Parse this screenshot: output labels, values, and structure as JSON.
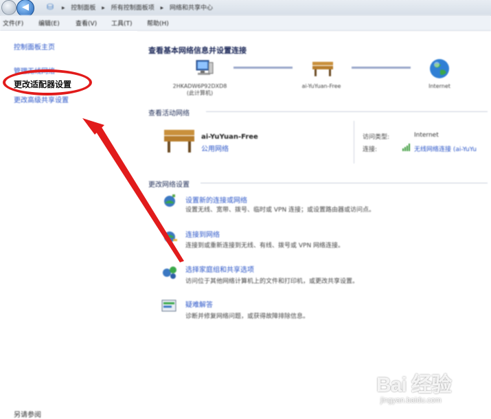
{
  "breadcrumb": [
    "▸",
    "控制面板",
    "▸",
    "所有控制面板项",
    "▸",
    "网络和共享中心"
  ],
  "menu": [
    "文件(F)",
    "编辑(E)",
    "查看(V)",
    "工具(T)",
    "帮助(H)"
  ],
  "left_panel": {
    "home": "控制面板主页",
    "manage_wireless": "管理无线网络",
    "change_adapter": "更改适配器设置",
    "change_sharing": "更改高级共享设置",
    "see_also": "另请参阅"
  },
  "main": {
    "title": "查看基本网络信息并设置连接",
    "map": {
      "computer_name": "2HKADW6P92DXD8",
      "computer_sub": "(此计算机)",
      "network_name": "ai-YuYuan-Free",
      "internet": "Internet"
    },
    "active_header": "查看活动网络",
    "active": {
      "name": "ai-YuYuan-Free",
      "type": "公用网络",
      "access_label": "访问类型:",
      "access_value": "Internet",
      "conn_label": "连接:",
      "conn_value": "无线网络连接 (ai-YuYu"
    },
    "change_header": "更改网络设置",
    "tasks": [
      {
        "title": "设置新的连接或网络",
        "desc": "设置无线、宽带、拨号、临时或 VPN 连接；或设置路由器或访问点。"
      },
      {
        "title": "连接到网络",
        "desc": "连接到或重新连接到无线、有线、拨号或 VPN 网络连接。"
      },
      {
        "title": "选择家庭组和共享选项",
        "desc": "访问位于其他网络计算机上的文件和打印机，或更改共享设置。"
      },
      {
        "title": "疑难解答",
        "desc": "诊断并修复网络问题，或获得故障排除信息。"
      }
    ]
  },
  "watermark": {
    "main": "Bai 经验",
    "sub": "jingyan.baidu.com"
  },
  "colors": {
    "annotation_red": "#e11b1b",
    "link_blue": "#2a55c8"
  }
}
